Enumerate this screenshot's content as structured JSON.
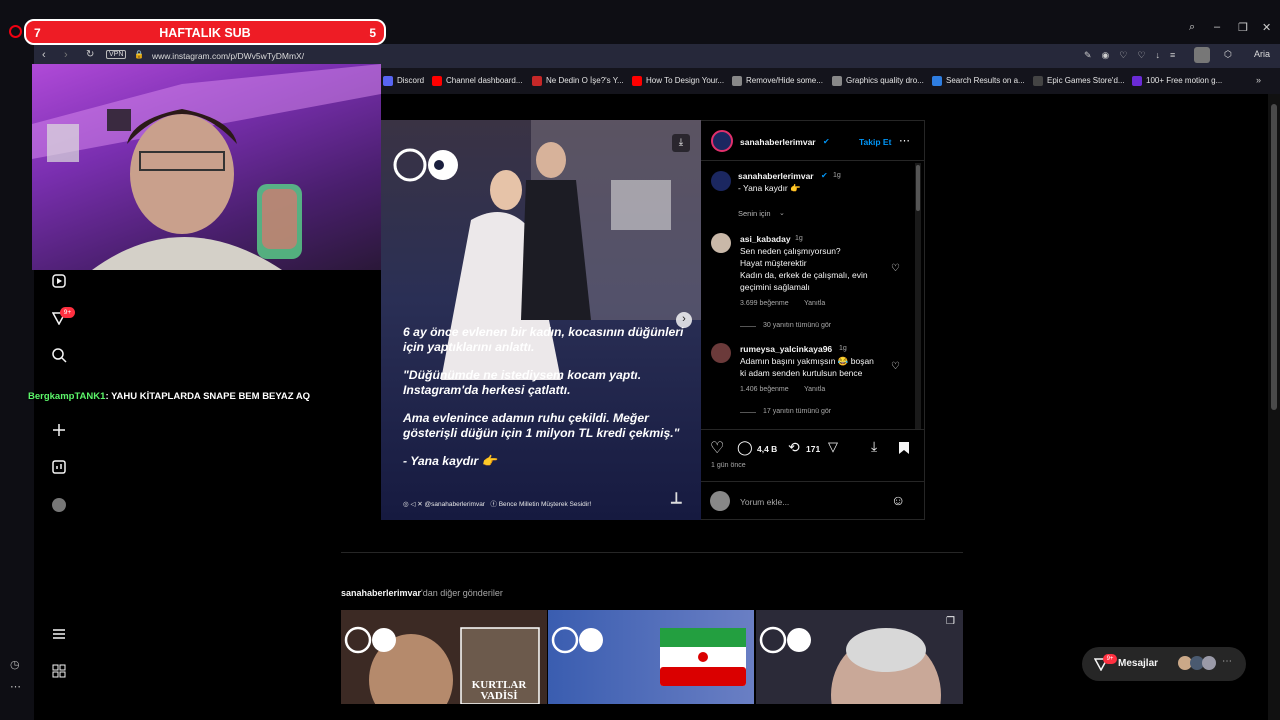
{
  "sub_banner": {
    "left_number": "7",
    "title": "HAFTALIK SUB",
    "right_number": "5"
  },
  "browser": {
    "url": "www.instagram.com/p/DWv5wTyDMmX/",
    "vpn_label": "VPN",
    "aria_label": "Aria",
    "bookmarks": [
      {
        "label": "Discord",
        "color": "#5865f2"
      },
      {
        "label": "Channel dashboard...",
        "color": "#ff0000"
      },
      {
        "label": "Ne Dedin O İşe?'s Y...",
        "color": "#c62828"
      },
      {
        "label": "How To Design Your...",
        "color": "#ff0000"
      },
      {
        "label": "Remove/Hide some...",
        "color": "#888888"
      },
      {
        "label": "Graphics quality dro...",
        "color": "#888888"
      },
      {
        "label": "Search Results on a...",
        "color": "#2e7de0"
      },
      {
        "label": "Epic Games Store'd...",
        "color": "#444444"
      },
      {
        "label": "100+ Free motion g...",
        "color": "#6a2bd6"
      }
    ]
  },
  "chat": {
    "user": "BergkampTANK1",
    "message": ": YAHU KİTAPLARDA SNAPE BEM BEYAZ AQ"
  },
  "nav": {
    "badge": "9+"
  },
  "post": {
    "account": "sanahaberlerimvar",
    "follow_label": "Takip Et",
    "caption_user": "sanahaberlerimvar",
    "caption_time": "1g",
    "caption_text": "- Yana kaydır 👉",
    "for_you_label": "Senin için",
    "comments": [
      {
        "user": "asi_kabaday",
        "time": "1g",
        "lines": [
          "Sen neden çalışmıyorsun?",
          "Hayat müşterektir",
          "Kadın da, erkek de çalışmalı, evin",
          "geçimini sağlamalı"
        ],
        "likes": "3.699 beğenme",
        "reply": "Yanıtla",
        "view_replies": "30 yanıtın tümünü gör"
      },
      {
        "user": "rumeysa_yalcinkaya96",
        "time": "1g",
        "lines": [
          "Adamın başını yakmışsın 😂 boşan",
          "ki adam senden kurtulsun bence"
        ],
        "likes": "1.406 beğenme",
        "reply": "Yanıtla",
        "view_replies": "17 yanıtın tümünü gör"
      }
    ],
    "comment_count": "4,4 B",
    "repost_count": "171",
    "posted_ago": "1 gün önce",
    "comment_placeholder": "Yorum ekle...",
    "image_quote": [
      "6 ay önce evlenen bir kadın, kocasının düğünleri için yaptıklarını anlattı.",
      "\"Düğünümde ne istediysem kocam yaptı. Instagram'da herkesi çatlattı.",
      "Ama evlenince adamın ruhu çekildi. Meğer gösterişli düğün için 1 milyon TL kredi çekmiş.\"",
      "- Yana kaydır 👉"
    ],
    "image_footer_handle": "@sanahaberlerimvar",
    "image_footer_page": "Bence Milletin Müşterek Sesidir!"
  },
  "more_posts": {
    "account": "sanahaberlerimvar",
    "suffix": "'dan diğer gönderiler",
    "thumb2_text": "KURTLAR VADİSİ"
  },
  "messages": {
    "label": "Mesajlar",
    "badge": "9+"
  },
  "colors": {
    "accent_blue": "#0095f6",
    "badge_red": "#ff3040",
    "banner_red": "#ee1c25"
  }
}
